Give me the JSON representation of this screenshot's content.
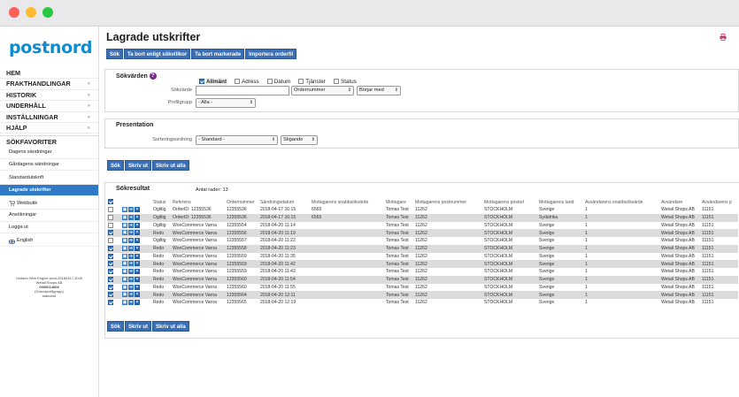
{
  "sidebar": {
    "logo": "postnord",
    "nav": [
      {
        "label": "HEM",
        "chev": ""
      },
      {
        "label": "FRAKTHANDLINGAR",
        "chev": "»"
      },
      {
        "label": "HISTORIK",
        "chev": "»"
      },
      {
        "label": "UNDERHÅLL",
        "chev": "»"
      },
      {
        "label": "INSTÄLLNINGAR",
        "chev": "»"
      },
      {
        "label": "HJÄLP",
        "chev": "»"
      }
    ],
    "favorites_title": "SÖKFAVORITER",
    "favorites": [
      "Dagens sändningar",
      "Gårdagens sändningar",
      "Standardutskrift",
      "Lagrade utskrifter"
    ],
    "other": [
      "Webbutik",
      "Ansökningar",
      "Logga ut"
    ],
    "language": "English",
    "footer": [
      "Unifaun Web Engine prod-20180417-1049",
      "Wetail Shops AB",
      "0000014608",
      "(Grundprofilgrupp)",
      "standard"
    ]
  },
  "main": {
    "title": "Lagrade utskrifter",
    "toolbar": [
      "Sök",
      "Ta bort enligt sökvillkor",
      "Ta bort markerade",
      "Importera orderfil"
    ],
    "search": {
      "header": "Sökvärden",
      "tabs": [
        {
          "label": "Allmänt",
          "checked": true
        },
        {
          "label": "Adress",
          "checked": false
        },
        {
          "label": "Datum",
          "checked": false
        },
        {
          "label": "Tjänster",
          "checked": false
        },
        {
          "label": "Status",
          "checked": false
        }
      ],
      "sokvarde_label": "Sökvärde",
      "sokvarde_value": "",
      "field_select": "Ordernummer",
      "match_select": "Börjar med",
      "profilgrupp_label": "Profilgrupp",
      "profilgrupp_value": "- Alla -"
    },
    "presentation": {
      "header": "Presentation",
      "sort_label": "Sorteringsordning",
      "sort_value": "- Standard -",
      "order_value": "Stigande"
    },
    "mid_buttons": [
      "Sök",
      "Skriv ut",
      "Skriv ut alla"
    ],
    "results": {
      "header": "Sökresultat",
      "count": "Antal rader: 13",
      "columns": [
        "",
        "",
        "Status",
        "Referens",
        "Ordernummer",
        "Sändningsdatum",
        "Mottagarens snabbsökvärde",
        "Mottagare",
        "Mottagarens postnummer",
        "Mottagarens postort",
        "Mottagarens land",
        "Avsändarens snabbsökvärde",
        "Avsändare",
        "Avsändarens p"
      ],
      "rows": [
        {
          "checked": false,
          "status": "Ogiltig",
          "ref": "OrderID: 12355536",
          "order": "12355536",
          "date": "2018-04-17 16:15",
          "quick": "6565",
          "recipient": "Tomas Test",
          "zip": "11262",
          "city": "STOCKHOLM",
          "country": "Sverige",
          "squick": "1",
          "sender": "Wetail Shops AB",
          "szip": "11151"
        },
        {
          "checked": false,
          "status": "Ogiltig",
          "ref": "OrderID: 12355536",
          "order": "12355536",
          "date": "2018-04-17 16:15",
          "quick": "6565",
          "recipient": "Tomas Test",
          "zip": "11262",
          "city": "STOCKHOLM",
          "country": "Sydafrika",
          "squick": "1",
          "sender": "Wetail Shops AB",
          "szip": "11151"
        },
        {
          "checked": false,
          "status": "Ogiltig",
          "ref": "WooCommerce Varna",
          "order": "12355554",
          "date": "2018-04-20 11:14",
          "quick": "",
          "recipient": "Tomas Test",
          "zip": "11262",
          "city": "STOCKHOLM",
          "country": "Sverige",
          "squick": "1",
          "sender": "Wetail Shops AB",
          "szip": "11151"
        },
        {
          "checked": true,
          "status": "Redo",
          "ref": "WooCommerce Varna",
          "order": "12355556",
          "date": "2018-04-20 11:19",
          "quick": "",
          "recipient": "Tomas Test",
          "zip": "11262",
          "city": "STOCKHOLM",
          "country": "Sverige",
          "squick": "1",
          "sender": "Wetail Shops AB",
          "szip": "11151"
        },
        {
          "checked": false,
          "status": "Ogiltig",
          "ref": "WooCommerce Varna",
          "order": "12355557",
          "date": "2018-04-20 11:22",
          "quick": "",
          "recipient": "Tomas Test",
          "zip": "11262",
          "city": "STOCKHOLM",
          "country": "Sverige",
          "squick": "1",
          "sender": "Wetail Shops AB",
          "szip": "11151"
        },
        {
          "checked": true,
          "status": "Redo",
          "ref": "WooCommerce Varna",
          "order": "12355558",
          "date": "2018-04-20 11:23",
          "quick": "",
          "recipient": "Tomas Test",
          "zip": "11262",
          "city": "STOCKHOLM",
          "country": "Sverige",
          "squick": "1",
          "sender": "Wetail Shops AB",
          "szip": "11151"
        },
        {
          "checked": true,
          "status": "Redo",
          "ref": "WooCommerce Varna",
          "order": "12355559",
          "date": "2018-04-20 11:35",
          "quick": "",
          "recipient": "Tomas Test",
          "zip": "11262",
          "city": "STOCKHOLM",
          "country": "Sverige",
          "squick": "1",
          "sender": "Wetail Shops AB",
          "szip": "11151"
        },
        {
          "checked": true,
          "status": "Redo",
          "ref": "WooCommerce Varna",
          "order": "12355559",
          "date": "2018-04-20 11:42",
          "quick": "",
          "recipient": "Tomas Test",
          "zip": "11262",
          "city": "STOCKHOLM",
          "country": "Sverige",
          "squick": "1",
          "sender": "Wetail Shops AB",
          "szip": "11151"
        },
        {
          "checked": true,
          "status": "Redo",
          "ref": "WooCommerce Varna",
          "order": "12355559",
          "date": "2018-04-20 11:43",
          "quick": "",
          "recipient": "Tomas Test",
          "zip": "11262",
          "city": "STOCKHOLM",
          "country": "Sverige",
          "squick": "1",
          "sender": "Wetail Shops AB",
          "szip": "11151"
        },
        {
          "checked": true,
          "status": "Redo",
          "ref": "WooCommerce Varna",
          "order": "12355560",
          "date": "2018-04-20 11:54",
          "quick": "",
          "recipient": "Tomas Test",
          "zip": "11262",
          "city": "STOCKHOLM",
          "country": "Sverige",
          "squick": "1",
          "sender": "Wetail Shops AB",
          "szip": "11151"
        },
        {
          "checked": true,
          "status": "Redo",
          "ref": "WooCommerce Varna",
          "order": "12355560",
          "date": "2018-04-20 11:55",
          "quick": "",
          "recipient": "Tomas Test",
          "zip": "11262",
          "city": "STOCKHOLM",
          "country": "Sverige",
          "squick": "1",
          "sender": "Wetail Shops AB",
          "szip": "11151"
        },
        {
          "checked": true,
          "status": "Redo",
          "ref": "WooCommerce Varna",
          "order": "12355564",
          "date": "2018-04-20 12:11",
          "quick": "",
          "recipient": "Tomas Test",
          "zip": "11262",
          "city": "STOCKHOLM",
          "country": "Sverige",
          "squick": "1",
          "sender": "Wetail Shops AB",
          "szip": "11151"
        },
        {
          "checked": true,
          "status": "Redo",
          "ref": "WooCommerce Varna",
          "order": "12355565",
          "date": "2018-04-20 12:19",
          "quick": "",
          "recipient": "Tomas Test",
          "zip": "11262",
          "city": "STOCKHOLM",
          "country": "Sverige",
          "squick": "1",
          "sender": "Wetail Shops AB",
          "szip": "11151"
        }
      ]
    },
    "bottom_buttons": [
      "Sök",
      "Skriv ut",
      "Skriv ut alla"
    ]
  },
  "colors": {
    "accent": "#3a6fb5",
    "brand": "#0d8ccf",
    "active_nav": "#2f79c6"
  }
}
